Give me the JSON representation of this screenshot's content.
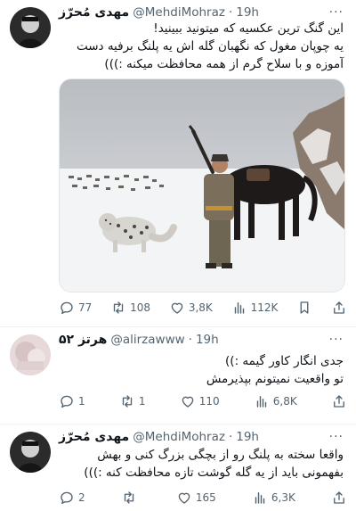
{
  "tweets": [
    {
      "name": "مهدی مُحرّز",
      "handle": "@MehdiMohraz",
      "time": "19h",
      "more": "···",
      "lines": [
        "این گنگ ترین عکسیه که میتونید ببینید!",
        "یه چوپان مغول که نگهبان گله اش یه پلنگ برفیه دست",
        "آموزه و با سلاح گرم از همه محافظت میکنه :)))"
      ],
      "stats": {
        "replies": "77",
        "retweets": "108",
        "likes": "3,8K",
        "views": "112K"
      }
    },
    {
      "name": "۵۲ هرتز",
      "handle": "@alirzawww",
      "time": "19h",
      "more": "···",
      "lines": [
        "جدی انگار کاور گیمه :))",
        "تو واقعیت نمیتونم بپذیرمش"
      ],
      "stats": {
        "replies": "1",
        "retweets": "1",
        "likes": "110",
        "views": "6,8K"
      }
    },
    {
      "name": "مهدی مُحرّز",
      "handle": "@MehdiMohraz",
      "time": "19h",
      "more": "···",
      "lines": [
        "واقعا سخته به پلنگ رو از بچگی بزرگ کنی و بهش",
        "بفهمونی باید از یه گله گوشت تازه محافظت کنه :)))"
      ],
      "stats": {
        "replies": "2",
        "retweets": "",
        "likes": "165",
        "views": "6,3K"
      }
    }
  ],
  "separator": "·",
  "colors": {
    "text": "#0f1419",
    "secondary": "#536471",
    "divider": "#eff3f4"
  },
  "icons": [
    "reply-icon",
    "retweet-icon",
    "like-icon",
    "views-icon",
    "bookmark-icon",
    "share-icon"
  ]
}
